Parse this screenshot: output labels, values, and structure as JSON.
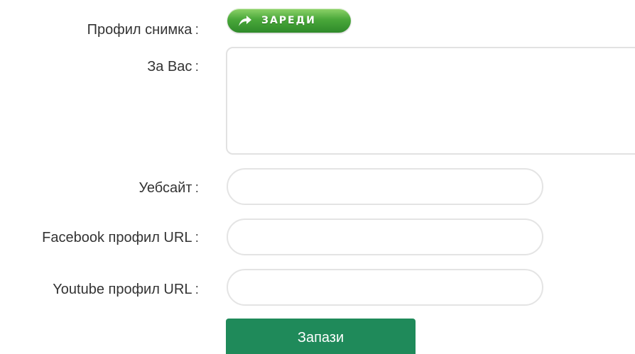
{
  "form": {
    "profile_photo_label": "Профил снимка",
    "about_label": "За Вас",
    "website_label": "Уебсайт",
    "facebook_label": "Facebook профил URL",
    "youtube_label": "Youtube профил URL",
    "colon": ":",
    "upload_button_label": "ЗАРЕДИ",
    "about_value": "",
    "website_value": "",
    "facebook_value": "",
    "youtube_value": "",
    "save_button_label": "Запази"
  },
  "colors": {
    "upload_green": "#4aa83a",
    "save_green": "#1f8a5a",
    "border_gray": "#e2e2e2"
  },
  "icons": {
    "upload": "upload-arrow-icon"
  }
}
